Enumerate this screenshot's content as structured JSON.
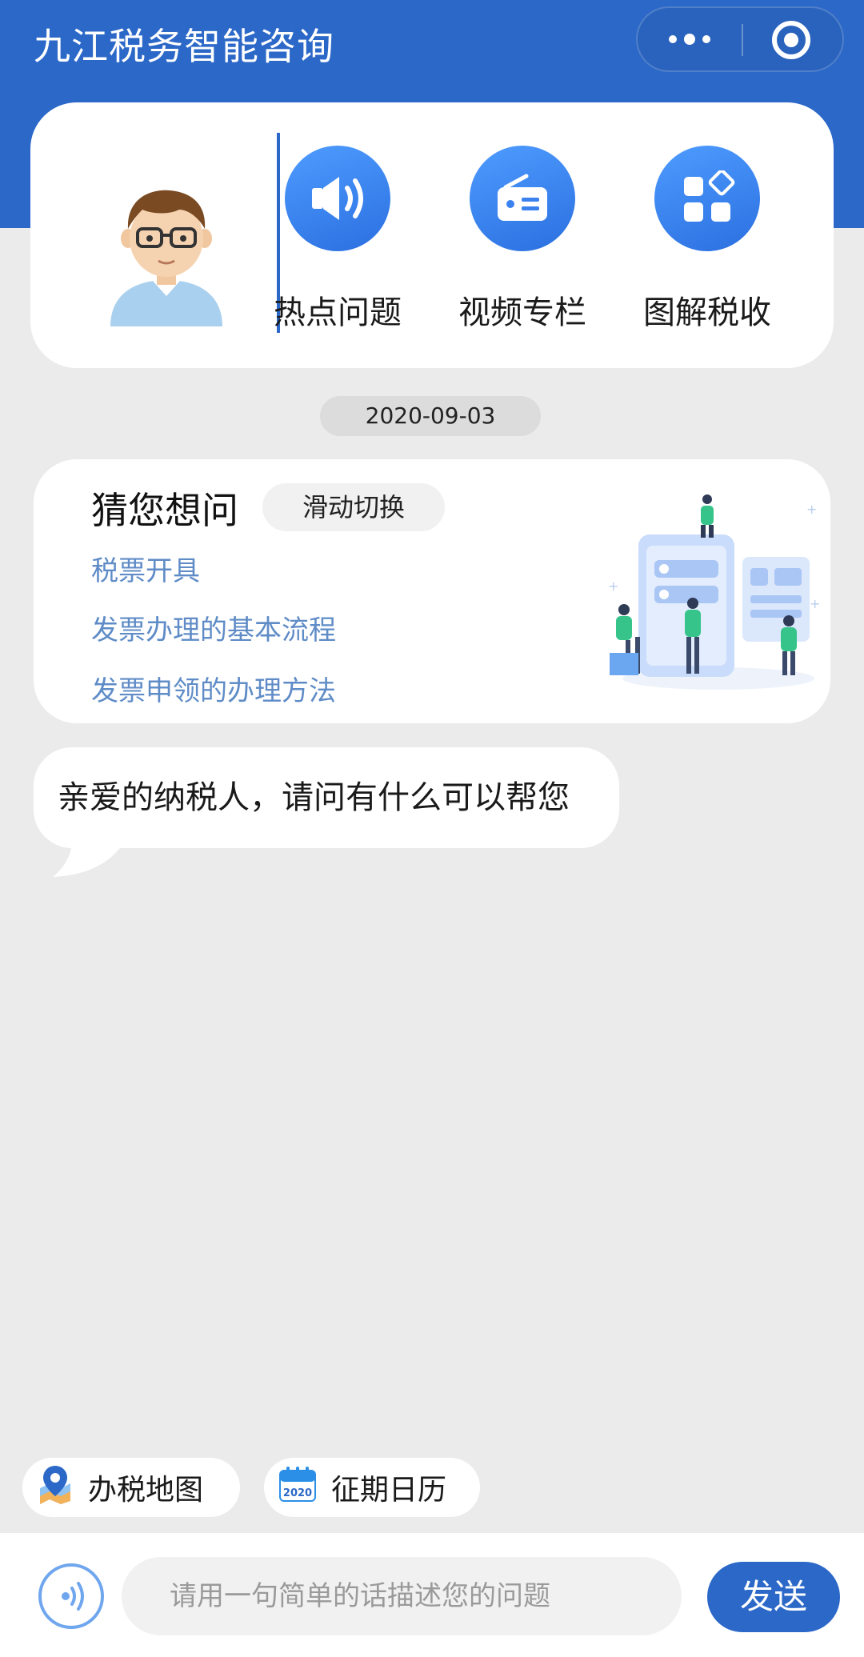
{
  "header": {
    "title": "九江税务智能咨询"
  },
  "menu": [
    {
      "label": "热点问题",
      "icon": "speaker-icon"
    },
    {
      "label": "视频专栏",
      "icon": "radio-icon"
    },
    {
      "label": "图解税收",
      "icon": "grid-icon"
    }
  ],
  "date": "2020-09-03",
  "guess": {
    "title": "猜您想问",
    "switch_label": "滑动切换",
    "links": [
      "税票开具",
      "发票办理的基本流程",
      "发票申领的办理方法"
    ]
  },
  "bot_message": "亲爱的纳税人，请问有什么可以帮您",
  "quick": [
    {
      "label": "办税地图",
      "icon": "map-pin-icon"
    },
    {
      "label": "征期日历",
      "icon": "calendar-icon",
      "icon_text": "2020"
    }
  ],
  "input": {
    "placeholder": "请用一句简单的话描述您的问题",
    "send_label": "发送"
  },
  "colors": {
    "brand_blue": "#2b68c8",
    "link_blue": "#5f8cc7",
    "background": "#ebebeb"
  }
}
